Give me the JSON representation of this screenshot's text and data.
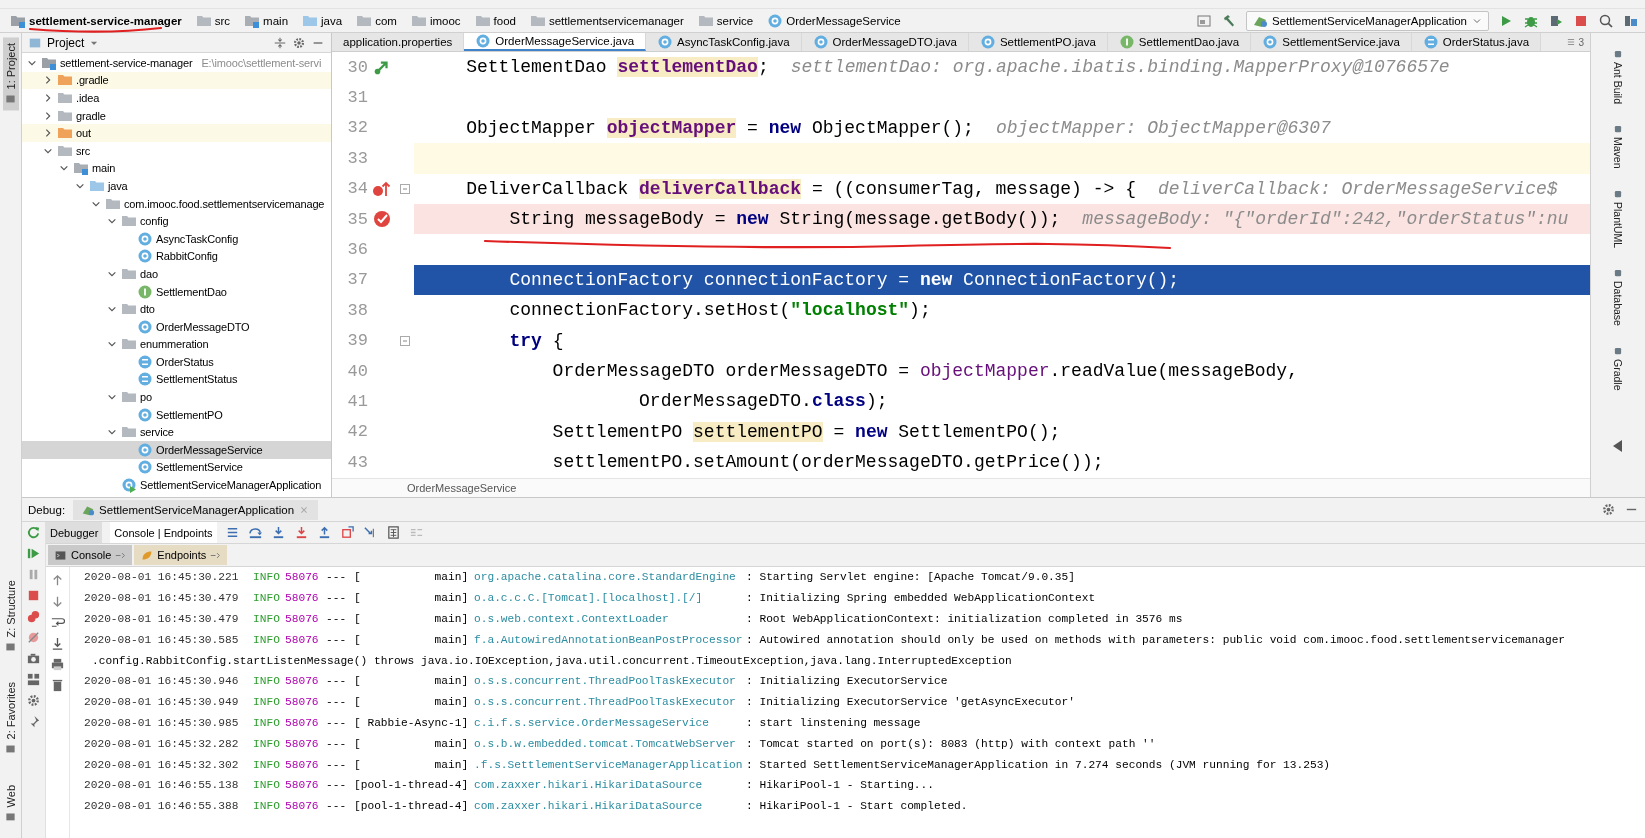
{
  "navbar": {
    "breadcrumbs": [
      {
        "label": "settlement-service-manager",
        "kind": "module"
      },
      {
        "label": "src",
        "kind": "folder"
      },
      {
        "label": "main",
        "kind": "module-folder"
      },
      {
        "label": "java",
        "kind": "source-folder"
      },
      {
        "label": "com",
        "kind": "folder"
      },
      {
        "label": "imooc",
        "kind": "folder"
      },
      {
        "label": "food",
        "kind": "folder"
      },
      {
        "label": "settlementservicemanager",
        "kind": "folder"
      },
      {
        "label": "service",
        "kind": "folder"
      },
      {
        "label": "OrderMessageService",
        "kind": "class"
      }
    ],
    "run_config": "SettlementServiceManagerApplication"
  },
  "left_strip": {
    "top": [
      {
        "label": "1: Project",
        "selected": true
      }
    ],
    "bottom": [
      {
        "label": "Z: Structure",
        "selected": false
      },
      {
        "label": "2: Favorites",
        "selected": false
      },
      {
        "label": "Web",
        "selected": false
      }
    ]
  },
  "project": {
    "title": "Project",
    "tree": [
      {
        "label": "settlement-service-manager",
        "path": "E:\\imooc\\settlement-servi",
        "kind": "module",
        "expanded": true,
        "selected": false,
        "children": [
          {
            "label": ".gradle",
            "kind": "excluded-folder",
            "expanded": false,
            "selected": false
          },
          {
            "label": ".idea",
            "kind": "folder",
            "expanded": false,
            "selected": false
          },
          {
            "label": "gradle",
            "kind": "folder",
            "expanded": false,
            "selected": false
          },
          {
            "label": "out",
            "kind": "excluded-folder",
            "expanded": false,
            "selected": false
          },
          {
            "label": "src",
            "kind": "folder",
            "expanded": true,
            "selected": false,
            "children": [
              {
                "label": "main",
                "kind": "module-folder",
                "expanded": true,
                "selected": false,
                "children": [
                  {
                    "label": "java",
                    "kind": "source-folder",
                    "expanded": true,
                    "selected": false,
                    "children": [
                      {
                        "label": "com.imooc.food.settlementservicemanage",
                        "kind": "folder",
                        "expanded": true,
                        "selected": false,
                        "children": [
                          {
                            "label": "config",
                            "kind": "folder",
                            "expanded": true,
                            "selected": false,
                            "children": [
                              {
                                "label": "AsyncTaskConfig",
                                "kind": "class",
                                "selected": false
                              },
                              {
                                "label": "RabbitConfig",
                                "kind": "class",
                                "selected": false
                              }
                            ]
                          },
                          {
                            "label": "dao",
                            "kind": "folder",
                            "expanded": true,
                            "selected": false,
                            "children": [
                              {
                                "label": "SettlementDao",
                                "kind": "interface",
                                "selected": false
                              }
                            ]
                          },
                          {
                            "label": "dto",
                            "kind": "folder",
                            "expanded": true,
                            "selected": false,
                            "children": [
                              {
                                "label": "OrderMessageDTO",
                                "kind": "class",
                                "selected": false
                              }
                            ]
                          },
                          {
                            "label": "enummeration",
                            "kind": "folder",
                            "expanded": true,
                            "selected": false,
                            "children": [
                              {
                                "label": "OrderStatus",
                                "kind": "enum",
                                "selected": false
                              },
                              {
                                "label": "SettlementStatus",
                                "kind": "enum",
                                "selected": false
                              }
                            ]
                          },
                          {
                            "label": "po",
                            "kind": "folder",
                            "expanded": true,
                            "selected": false,
                            "children": [
                              {
                                "label": "SettlementPO",
                                "kind": "class",
                                "selected": false
                              }
                            ]
                          },
                          {
                            "label": "service",
                            "kind": "folder",
                            "expanded": true,
                            "selected": false,
                            "children": [
                              {
                                "label": "OrderMessageService",
                                "kind": "class",
                                "selected": true
                              },
                              {
                                "label": "SettlementService",
                                "kind": "class",
                                "selected": false
                              }
                            ]
                          },
                          {
                            "label": "SettlementServiceManagerApplication",
                            "kind": "app",
                            "selected": false
                          }
                        ]
                      }
                    ]
                  }
                ]
              }
            ]
          }
        ]
      }
    ]
  },
  "editor": {
    "tabs": [
      {
        "label": "application.properties",
        "kind": "properties",
        "selected": false
      },
      {
        "label": "OrderMessageService.java",
        "kind": "class",
        "selected": true
      },
      {
        "label": "AsyncTaskConfig.java",
        "kind": "class",
        "selected": false
      },
      {
        "label": "OrderMessageDTO.java",
        "kind": "class",
        "selected": false
      },
      {
        "label": "SettlementPO.java",
        "kind": "class",
        "selected": false
      },
      {
        "label": "SettlementDao.java",
        "kind": "interface",
        "selected": false
      },
      {
        "label": "SettlementService.java",
        "kind": "class",
        "selected": false
      },
      {
        "label": "OrderStatus.java",
        "kind": "enum",
        "selected": false
      }
    ],
    "hidden_tabs_count": "3",
    "lines": [
      {
        "number": "30",
        "implemented": true,
        "lambda": false,
        "breakpoint": false,
        "caret": false,
        "execution": false,
        "fold": false,
        "tokens": [
          {
            "kind": "plain",
            "text": "    SettlementDao "
          },
          {
            "kind": "field-decl",
            "text": "settlementDao"
          },
          {
            "kind": "plain",
            "text": ";"
          }
        ],
        "hint": "settlementDao: org.apache.ibatis.binding.MapperProxy@1076657e"
      },
      {
        "number": "31",
        "implemented": false,
        "lambda": false,
        "breakpoint": false,
        "caret": false,
        "execution": false,
        "fold": false
      },
      {
        "number": "32",
        "implemented": false,
        "lambda": false,
        "breakpoint": false,
        "caret": false,
        "execution": false,
        "fold": false,
        "tokens": [
          {
            "kind": "plain",
            "text": "    ObjectMapper "
          },
          {
            "kind": "field-decl",
            "text": "objectMapper"
          },
          {
            "kind": "plain",
            "text": " = "
          },
          {
            "kind": "keyword",
            "text": "new"
          },
          {
            "kind": "plain",
            "text": " ObjectMapper();"
          }
        ],
        "hint": "objectMapper: ObjectMapper@6307"
      },
      {
        "number": "33",
        "implemented": false,
        "lambda": false,
        "breakpoint": false,
        "caret": true,
        "execution": false,
        "fold": false
      },
      {
        "number": "34",
        "implemented": false,
        "lambda": true,
        "breakpoint": false,
        "caret": false,
        "execution": false,
        "fold": true,
        "tokens": [
          {
            "kind": "plain",
            "text": "    DeliverCallback "
          },
          {
            "kind": "field-decl",
            "text": "deliverCallback"
          },
          {
            "kind": "plain",
            "text": " = ((consumerTag, message) -> {"
          }
        ],
        "hint": "deliverCallback: OrderMessageService$"
      },
      {
        "number": "35",
        "implemented": false,
        "lambda": false,
        "breakpoint": true,
        "caret": false,
        "execution": false,
        "fold": false,
        "tokens": [
          {
            "kind": "plain",
            "text": "        String messageBody = "
          },
          {
            "kind": "keyword",
            "text": "new"
          },
          {
            "kind": "plain",
            "text": " String(message.getBody());"
          }
        ],
        "hint": "messageBody: \"{\"orderId\":242,\"orderStatus\":nu"
      },
      {
        "number": "36",
        "implemented": false,
        "lambda": false,
        "breakpoint": false,
        "caret": false,
        "execution": false,
        "fold": false
      },
      {
        "number": "37",
        "implemented": false,
        "lambda": false,
        "breakpoint": false,
        "caret": false,
        "execution": true,
        "fold": false,
        "tokens": [
          {
            "kind": "plain",
            "text": "        ConnectionFactory connectionFactory = "
          },
          {
            "kind": "keyword",
            "text": "new"
          },
          {
            "kind": "plain",
            "text": " ConnectionFactory();"
          }
        ]
      },
      {
        "number": "38",
        "implemented": false,
        "lambda": false,
        "breakpoint": false,
        "caret": false,
        "execution": false,
        "fold": false,
        "tokens": [
          {
            "kind": "plain",
            "text": "        connectionFactory.setHost("
          },
          {
            "kind": "string",
            "text": "\"localhost\""
          },
          {
            "kind": "plain",
            "text": ");"
          }
        ]
      },
      {
        "number": "39",
        "implemented": false,
        "lambda": false,
        "breakpoint": false,
        "caret": false,
        "execution": false,
        "fold": true,
        "tokens": [
          {
            "kind": "keyword",
            "text": "        try"
          },
          {
            "kind": "plain",
            "text": " {"
          }
        ]
      },
      {
        "number": "40",
        "implemented": false,
        "lambda": false,
        "breakpoint": false,
        "caret": false,
        "execution": false,
        "fold": false,
        "tokens": [
          {
            "kind": "plain",
            "text": "            OrderMessageDTO orderMessageDTO = "
          },
          {
            "kind": "field",
            "text": "objectMapper"
          },
          {
            "kind": "plain",
            "text": ".readValue(messageBody,"
          }
        ]
      },
      {
        "number": "41",
        "implemented": false,
        "lambda": false,
        "breakpoint": false,
        "caret": false,
        "execution": false,
        "fold": false,
        "tokens": [
          {
            "kind": "plain",
            "text": "                    OrderMessageDTO."
          },
          {
            "kind": "keyword",
            "text": "class"
          },
          {
            "kind": "plain",
            "text": ");"
          }
        ]
      },
      {
        "number": "42",
        "implemented": false,
        "lambda": false,
        "breakpoint": false,
        "caret": false,
        "execution": false,
        "fold": false,
        "tokens": [
          {
            "kind": "plain",
            "text": "            SettlementPO "
          },
          {
            "kind": "highlighted",
            "text": "settlementPO"
          },
          {
            "kind": "plain",
            "text": " = "
          },
          {
            "kind": "keyword",
            "text": "new"
          },
          {
            "kind": "plain",
            "text": " SettlementPO();"
          }
        ]
      },
      {
        "number": "43",
        "implemented": false,
        "lambda": false,
        "breakpoint": false,
        "caret": false,
        "execution": false,
        "fold": false,
        "tokens": [
          {
            "kind": "plain",
            "text": "            settlementPO.setAmount(orderMessageDTO.getPrice());"
          }
        ]
      }
    ],
    "breadcrumb": "OrderMessageService"
  },
  "right_strip": [
    {
      "label": "Ant Build"
    },
    {
      "label": "Maven"
    },
    {
      "label": "PlantUML"
    },
    {
      "label": "Database"
    },
    {
      "label": "Gradle"
    }
  ],
  "debug": {
    "label": "Debug:",
    "session": "SettlementServiceManagerApplication",
    "tabs": [
      {
        "label": "Debugger",
        "selected": false
      },
      {
        "label": "Console | Endpoints",
        "selected": true
      }
    ],
    "console_tabs": [
      {
        "label": "Console",
        "selected": true
      },
      {
        "label": "Endpoints",
        "selected": false
      }
    ],
    "log": [
      {
        "kind": "entry",
        "time": "2020-08-01 16:45:30.221",
        "level": "INFO",
        "pid": "58076",
        "sep": "---",
        "thread": "[           main]",
        "logger": "org.apache.catalina.core.StandardEngine",
        "message": ": Starting Servlet engine: [Apache Tomcat/9.0.35]"
      },
      {
        "kind": "entry",
        "time": "2020-08-01 16:45:30.479",
        "level": "INFO",
        "pid": "58076",
        "sep": "---",
        "thread": "[           main]",
        "logger": "o.a.c.c.C.[Tomcat].[localhost].[/]",
        "message": ": Initializing Spring embedded WebApplicationContext"
      },
      {
        "kind": "entry",
        "time": "2020-08-01 16:45:30.479",
        "level": "INFO",
        "pid": "58076",
        "sep": "---",
        "thread": "[           main]",
        "logger": "o.s.web.context.ContextLoader",
        "message": ": Root WebApplicationContext: initialization completed in 3576 ms"
      },
      {
        "kind": "entry",
        "time": "2020-08-01 16:45:30.585",
        "level": "INFO",
        "pid": "58076",
        "sep": "---",
        "thread": "[           main]",
        "logger": "f.a.AutowiredAnnotationBeanPostProcessor",
        "message": ": Autowired annotation should only be used on methods with parameters: public void com.imooc.food.settlementservicemanager"
      },
      {
        "kind": "continuation",
        "text": ".config.RabbitConfig.startListenMessage() throws java.io.IOException,java.util.concurrent.TimeoutException,java.lang.InterruptedException"
      },
      {
        "kind": "entry",
        "time": "2020-08-01 16:45:30.946",
        "level": "INFO",
        "pid": "58076",
        "sep": "---",
        "thread": "[           main]",
        "logger": "o.s.s.concurrent.ThreadPoolTaskExecutor",
        "message": ": Initializing ExecutorService"
      },
      {
        "kind": "entry",
        "time": "2020-08-01 16:45:30.949",
        "level": "INFO",
        "pid": "58076",
        "sep": "---",
        "thread": "[           main]",
        "logger": "o.s.s.concurrent.ThreadPoolTaskExecutor",
        "message": ": Initializing ExecutorService 'getAsyncExecutor'"
      },
      {
        "kind": "entry",
        "time": "2020-08-01 16:45:30.985",
        "level": "INFO",
        "pid": "58076",
        "sep": "---",
        "thread": "[ Rabbie-Async-1]",
        "logger": "c.i.f.s.service.OrderMessageService",
        "message": ": start linstening message"
      },
      {
        "kind": "entry",
        "time": "2020-08-01 16:45:32.282",
        "level": "INFO",
        "pid": "58076",
        "sep": "---",
        "thread": "[           main]",
        "logger": "o.s.b.w.embedded.tomcat.TomcatWebServer",
        "message": ": Tomcat started on port(s): 8083 (http) with context path ''"
      },
      {
        "kind": "entry",
        "time": "2020-08-01 16:45:32.302",
        "level": "INFO",
        "pid": "58076",
        "sep": "---",
        "thread": "[           main]",
        "logger": ".f.s.SettlementServiceManagerApplication",
        "message": ": Started SettlementServiceManagerApplication in 7.274 seconds (JVM running for 13.253)"
      },
      {
        "kind": "entry",
        "time": "2020-08-01 16:46:55.138",
        "level": "INFO",
        "pid": "58076",
        "sep": "---",
        "thread": "[pool-1-thread-4]",
        "logger": "com.zaxxer.hikari.HikariDataSource",
        "message": ": HikariPool-1 - Starting..."
      },
      {
        "kind": "entry",
        "time": "2020-08-01 16:46:55.388",
        "level": "INFO",
        "pid": "58076",
        "sep": "---",
        "thread": "[pool-1-thread-4]",
        "logger": "com.zaxxer.hikari.HikariDataSource",
        "message": ": HikariPool-1 - Start completed."
      }
    ]
  }
}
